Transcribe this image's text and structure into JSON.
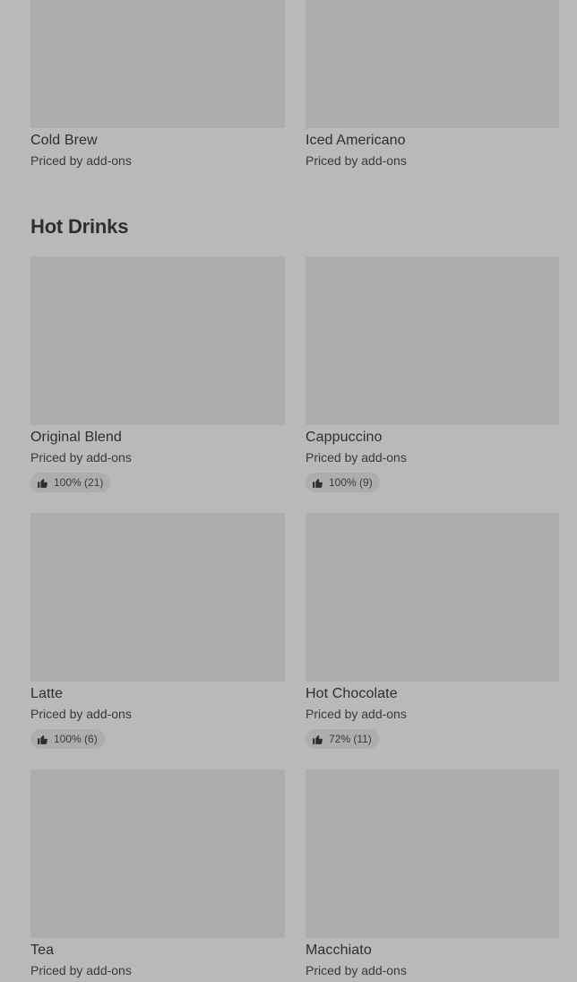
{
  "top_row": [
    {
      "name": "Cold Brew",
      "price": "Priced by add-ons"
    },
    {
      "name": "Iced Americano",
      "price": "Priced by add-ons"
    }
  ],
  "hot_drinks": {
    "title": "Hot Drinks",
    "items": [
      {
        "name": "Original Blend",
        "price": "Priced by add-ons",
        "rating": "100% (21)",
        "icon": "thumbs-up-icon"
      },
      {
        "name": "Cappuccino",
        "price": "Priced by add-ons",
        "rating": "100% (9)",
        "icon": "thumbs-up-icon"
      },
      {
        "name": "Latte",
        "price": "Priced by add-ons",
        "rating": "100% (6)",
        "icon": "thumbs-up-icon"
      },
      {
        "name": "Hot Chocolate",
        "price": "Priced by add-ons",
        "rating": "72% (11)",
        "icon": "thumbs-up-icon"
      },
      {
        "name": "Tea",
        "price": "Priced by add-ons"
      },
      {
        "name": "Macchiato",
        "price": "Priced by add-ons"
      }
    ]
  }
}
